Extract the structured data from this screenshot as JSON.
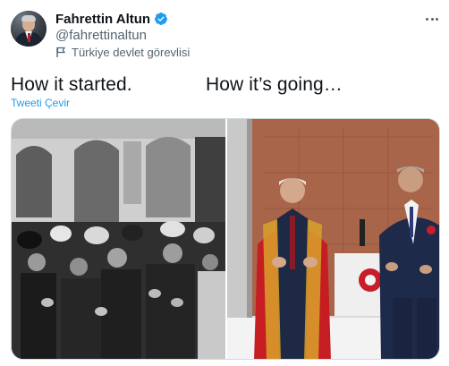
{
  "author": {
    "display_name": "Fahrettin Altun",
    "handle": "@fahrettinaltun",
    "label": "Türkiye devlet görevlisi",
    "verified": true,
    "verified_color": "#1d9bf0"
  },
  "tweet": {
    "text_left": "How it started.",
    "text_right": "How it’s going…",
    "translate_label": "Tweeti Çevir"
  },
  "media": {
    "photos": [
      {
        "kind": "black-and-white historical crowd photo"
      },
      {
        "kind": "color ceremony photo"
      }
    ]
  },
  "colors": {
    "text": "#0f1419",
    "secondary": "#536471",
    "accent": "#1d9bf0",
    "border": "#cfd9de"
  },
  "icons": {
    "verified": "verified-badge-icon",
    "label": "flag-icon",
    "more": "more-dots-icon"
  }
}
